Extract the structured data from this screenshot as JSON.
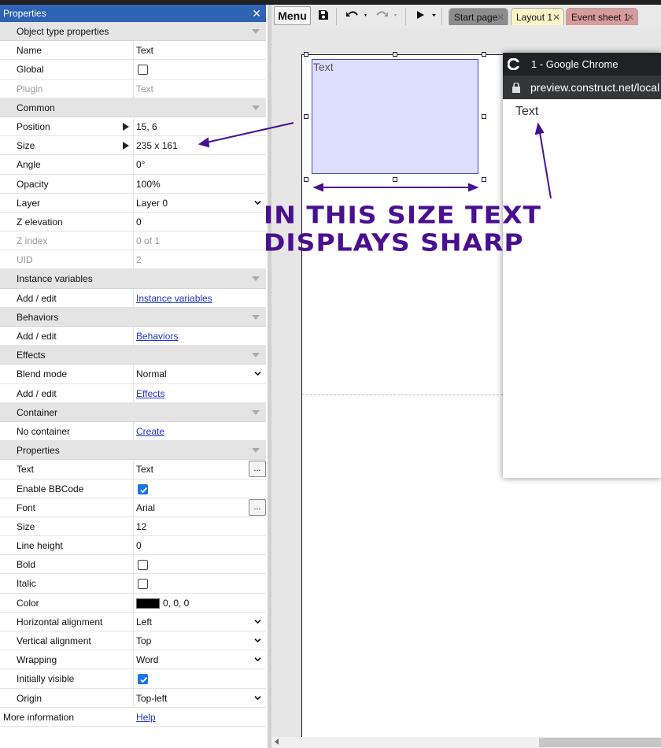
{
  "panel": {
    "title": "Properties",
    "close_icon": "close-icon"
  },
  "rows": [
    {
      "type": "cat",
      "label": "Object type properties"
    },
    {
      "type": "text",
      "label": "Name",
      "value": "Text"
    },
    {
      "type": "check",
      "label": "Global",
      "checked": false
    },
    {
      "type": "text",
      "label": "Plugin",
      "value": "Text",
      "disabled": true
    },
    {
      "type": "cat",
      "label": "Common"
    },
    {
      "type": "expand",
      "label": "Position",
      "value": "15, 6"
    },
    {
      "type": "expand",
      "label": "Size",
      "value": "235 x 161"
    },
    {
      "type": "text",
      "label": "Angle",
      "value": "0°"
    },
    {
      "type": "text",
      "label": "Opacity",
      "value": "100%"
    },
    {
      "type": "select",
      "label": "Layer",
      "value": "Layer 0"
    },
    {
      "type": "text",
      "label": "Z elevation",
      "value": "0"
    },
    {
      "type": "text",
      "label": "Z index",
      "value": "0 of 1",
      "disabled": true
    },
    {
      "type": "text",
      "label": "UID",
      "value": "2",
      "disabled": true
    },
    {
      "type": "cat",
      "label": "Instance variables"
    },
    {
      "type": "link",
      "label": "Add / edit",
      "value": "Instance variables"
    },
    {
      "type": "cat",
      "label": "Behaviors"
    },
    {
      "type": "link",
      "label": "Add / edit",
      "value": "Behaviors"
    },
    {
      "type": "cat",
      "label": "Effects"
    },
    {
      "type": "select",
      "label": "Blend mode",
      "value": "Normal"
    },
    {
      "type": "link",
      "label": "Add / edit",
      "value": "Effects"
    },
    {
      "type": "cat",
      "label": "Container"
    },
    {
      "type": "link",
      "label": "No container",
      "value": "Create"
    },
    {
      "type": "cat",
      "label": "Properties"
    },
    {
      "type": "dots",
      "label": "Text",
      "value": "Text",
      "button": "..."
    },
    {
      "type": "check",
      "label": "Enable BBCode",
      "checked": true
    },
    {
      "type": "dots",
      "label": "Font",
      "value": "Arial",
      "button": "..."
    },
    {
      "type": "text",
      "label": "Size",
      "value": "12"
    },
    {
      "type": "text",
      "label": "Line height",
      "value": "0"
    },
    {
      "type": "check",
      "label": "Bold",
      "checked": false
    },
    {
      "type": "check",
      "label": "Italic",
      "checked": false
    },
    {
      "type": "color",
      "label": "Color",
      "value": "0, 0, 0",
      "swatch": "#000000"
    },
    {
      "type": "select",
      "label": "Horizontal alignment",
      "value": "Left"
    },
    {
      "type": "select",
      "label": "Vertical alignment",
      "value": "Top"
    },
    {
      "type": "select",
      "label": "Wrapping",
      "value": "Word"
    },
    {
      "type": "check",
      "label": "Initially visible",
      "checked": true
    },
    {
      "type": "select",
      "label": "Origin",
      "value": "Top-left"
    },
    {
      "type": "last",
      "label": "More information",
      "value": "Help"
    }
  ],
  "toolbar": {
    "menu_label": "Menu",
    "icons": [
      "save-icon",
      "undo-icon",
      "redo-icon",
      "play-icon"
    ],
    "tabs": [
      {
        "label": "Start page",
        "bg": "#8c8c8c",
        "active": false
      },
      {
        "label": "Layout 1",
        "bg": "#fbf4c8",
        "active": true
      },
      {
        "label": "Event sheet 1",
        "bg": "#d79b9b",
        "active": false
      }
    ]
  },
  "layout": {
    "object_text": "Text",
    "annotation_line1": "IN THIS SIZE  TEXT",
    "annotation_line2": "DISPLAYS SHARP"
  },
  "chrome": {
    "title": "1 - Google Chrome",
    "url": "preview.construct.net/local",
    "content_text": "Text"
  },
  "colors": {
    "panel_header": "#2f63b3",
    "annotation": "#4a0f8f",
    "selection_fill": "#dedeff",
    "selection_border": "#4646b8"
  }
}
